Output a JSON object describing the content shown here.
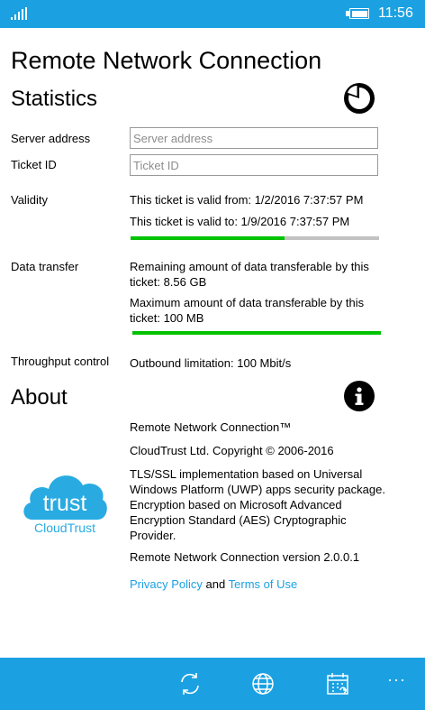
{
  "status_bar": {
    "time": "11:56",
    "signal_icon": "signal-strength-icon",
    "battery_icon": "battery-charging-icon"
  },
  "app": {
    "title": "Remote Network Connection"
  },
  "statistics": {
    "heading": "Statistics",
    "icon": "pie-chart-icon",
    "server_address": {
      "label": "Server address",
      "placeholder": "Server address",
      "value": ""
    },
    "ticket_id": {
      "label": "Ticket ID",
      "placeholder": "Ticket ID",
      "value": ""
    },
    "validity": {
      "label": "Validity",
      "valid_from": "This ticket is valid from: 1/2/2016 7:37:57 PM",
      "valid_to": "This ticket is valid to: 1/9/2016 7:37:57 PM",
      "progress": 0.62
    },
    "data_transfer": {
      "label": "Data transfer",
      "remaining": "Remaining amount of data transferable by this ticket: 8.56 GB",
      "maximum": "Maximum amount of data transferable by this ticket: 100 MB",
      "progress": 1.0
    },
    "throughput": {
      "label": "Throughput control",
      "value": "Outbound limitation: 100 Mbit/s"
    }
  },
  "about": {
    "heading": "About",
    "icon": "info-icon",
    "product": "Remote Network Connection™",
    "copyright": "CloudTrust Ltd. Copyright © 2006-2016",
    "tls_note": "TLS/SSL implementation based on Universal Windows Platform (UWP) apps security package. Encryption based on Microsoft Advanced Encryption Standard (AES) Cryptographic Provider.",
    "version": "Remote Network Connection version 2.0.0.1",
    "privacy_link": "Privacy Policy",
    "and_text": "and",
    "terms_link": "Terms of Use",
    "logo": {
      "word": "trust",
      "brand": "CloudTrust",
      "color": "#29abe2"
    }
  },
  "app_bar": {
    "buttons": [
      "refresh-icon",
      "globe-icon",
      "calendar-icon"
    ],
    "more": "···"
  },
  "colors": {
    "accent": "#1ba1e2",
    "progress_fill": "#00c200",
    "progress_track": "#c2c2c2"
  }
}
